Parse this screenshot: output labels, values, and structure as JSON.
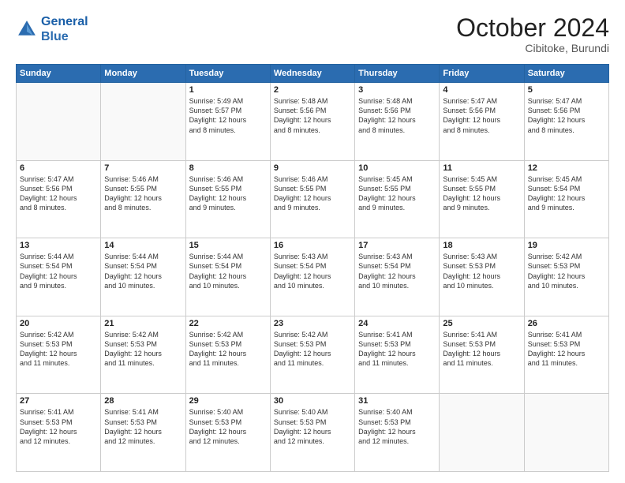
{
  "header": {
    "logo_line1": "General",
    "logo_line2": "Blue",
    "month": "October 2024",
    "location": "Cibitoke, Burundi"
  },
  "days_of_week": [
    "Sunday",
    "Monday",
    "Tuesday",
    "Wednesday",
    "Thursday",
    "Friday",
    "Saturday"
  ],
  "weeks": [
    [
      {
        "day": "",
        "text": ""
      },
      {
        "day": "",
        "text": ""
      },
      {
        "day": "1",
        "text": "Sunrise: 5:49 AM\nSunset: 5:57 PM\nDaylight: 12 hours\nand 8 minutes."
      },
      {
        "day": "2",
        "text": "Sunrise: 5:48 AM\nSunset: 5:56 PM\nDaylight: 12 hours\nand 8 minutes."
      },
      {
        "day": "3",
        "text": "Sunrise: 5:48 AM\nSunset: 5:56 PM\nDaylight: 12 hours\nand 8 minutes."
      },
      {
        "day": "4",
        "text": "Sunrise: 5:47 AM\nSunset: 5:56 PM\nDaylight: 12 hours\nand 8 minutes."
      },
      {
        "day": "5",
        "text": "Sunrise: 5:47 AM\nSunset: 5:56 PM\nDaylight: 12 hours\nand 8 minutes."
      }
    ],
    [
      {
        "day": "6",
        "text": "Sunrise: 5:47 AM\nSunset: 5:56 PM\nDaylight: 12 hours\nand 8 minutes."
      },
      {
        "day": "7",
        "text": "Sunrise: 5:46 AM\nSunset: 5:55 PM\nDaylight: 12 hours\nand 8 minutes."
      },
      {
        "day": "8",
        "text": "Sunrise: 5:46 AM\nSunset: 5:55 PM\nDaylight: 12 hours\nand 9 minutes."
      },
      {
        "day": "9",
        "text": "Sunrise: 5:46 AM\nSunset: 5:55 PM\nDaylight: 12 hours\nand 9 minutes."
      },
      {
        "day": "10",
        "text": "Sunrise: 5:45 AM\nSunset: 5:55 PM\nDaylight: 12 hours\nand 9 minutes."
      },
      {
        "day": "11",
        "text": "Sunrise: 5:45 AM\nSunset: 5:55 PM\nDaylight: 12 hours\nand 9 minutes."
      },
      {
        "day": "12",
        "text": "Sunrise: 5:45 AM\nSunset: 5:54 PM\nDaylight: 12 hours\nand 9 minutes."
      }
    ],
    [
      {
        "day": "13",
        "text": "Sunrise: 5:44 AM\nSunset: 5:54 PM\nDaylight: 12 hours\nand 9 minutes."
      },
      {
        "day": "14",
        "text": "Sunrise: 5:44 AM\nSunset: 5:54 PM\nDaylight: 12 hours\nand 10 minutes."
      },
      {
        "day": "15",
        "text": "Sunrise: 5:44 AM\nSunset: 5:54 PM\nDaylight: 12 hours\nand 10 minutes."
      },
      {
        "day": "16",
        "text": "Sunrise: 5:43 AM\nSunset: 5:54 PM\nDaylight: 12 hours\nand 10 minutes."
      },
      {
        "day": "17",
        "text": "Sunrise: 5:43 AM\nSunset: 5:54 PM\nDaylight: 12 hours\nand 10 minutes."
      },
      {
        "day": "18",
        "text": "Sunrise: 5:43 AM\nSunset: 5:53 PM\nDaylight: 12 hours\nand 10 minutes."
      },
      {
        "day": "19",
        "text": "Sunrise: 5:42 AM\nSunset: 5:53 PM\nDaylight: 12 hours\nand 10 minutes."
      }
    ],
    [
      {
        "day": "20",
        "text": "Sunrise: 5:42 AM\nSunset: 5:53 PM\nDaylight: 12 hours\nand 11 minutes."
      },
      {
        "day": "21",
        "text": "Sunrise: 5:42 AM\nSunset: 5:53 PM\nDaylight: 12 hours\nand 11 minutes."
      },
      {
        "day": "22",
        "text": "Sunrise: 5:42 AM\nSunset: 5:53 PM\nDaylight: 12 hours\nand 11 minutes."
      },
      {
        "day": "23",
        "text": "Sunrise: 5:42 AM\nSunset: 5:53 PM\nDaylight: 12 hours\nand 11 minutes."
      },
      {
        "day": "24",
        "text": "Sunrise: 5:41 AM\nSunset: 5:53 PM\nDaylight: 12 hours\nand 11 minutes."
      },
      {
        "day": "25",
        "text": "Sunrise: 5:41 AM\nSunset: 5:53 PM\nDaylight: 12 hours\nand 11 minutes."
      },
      {
        "day": "26",
        "text": "Sunrise: 5:41 AM\nSunset: 5:53 PM\nDaylight: 12 hours\nand 11 minutes."
      }
    ],
    [
      {
        "day": "27",
        "text": "Sunrise: 5:41 AM\nSunset: 5:53 PM\nDaylight: 12 hours\nand 12 minutes."
      },
      {
        "day": "28",
        "text": "Sunrise: 5:41 AM\nSunset: 5:53 PM\nDaylight: 12 hours\nand 12 minutes."
      },
      {
        "day": "29",
        "text": "Sunrise: 5:40 AM\nSunset: 5:53 PM\nDaylight: 12 hours\nand 12 minutes."
      },
      {
        "day": "30",
        "text": "Sunrise: 5:40 AM\nSunset: 5:53 PM\nDaylight: 12 hours\nand 12 minutes."
      },
      {
        "day": "31",
        "text": "Sunrise: 5:40 AM\nSunset: 5:53 PM\nDaylight: 12 hours\nand 12 minutes."
      },
      {
        "day": "",
        "text": ""
      },
      {
        "day": "",
        "text": ""
      }
    ]
  ]
}
